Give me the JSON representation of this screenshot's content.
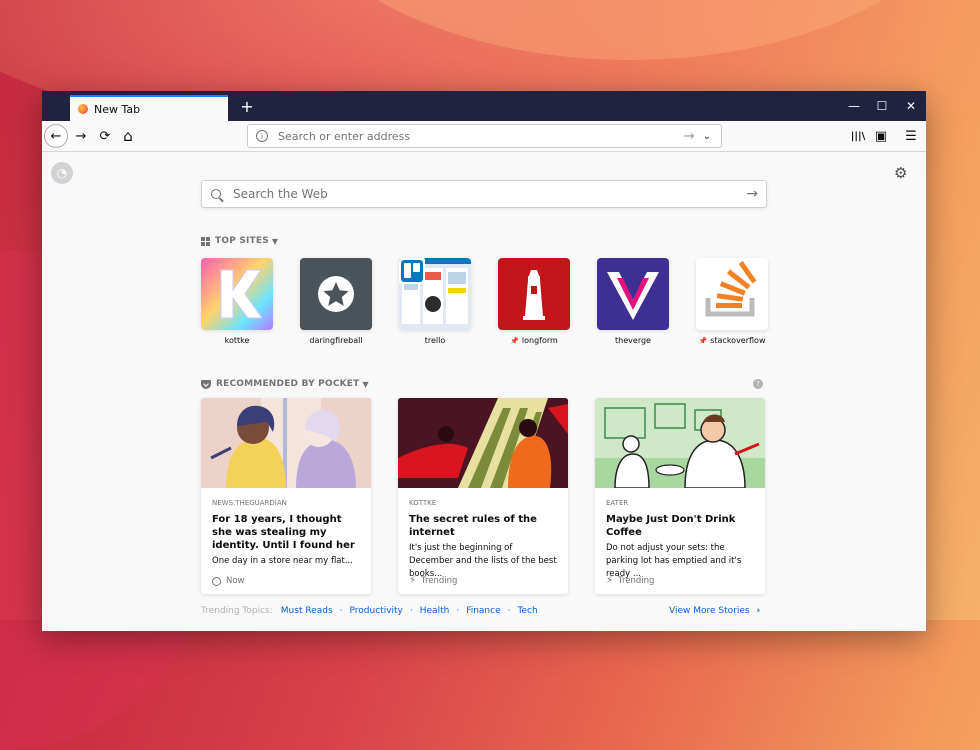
{
  "tab": {
    "title": "New Tab"
  },
  "titlebar": {
    "new_tab": "+",
    "minimize": "—",
    "maximize": "☐",
    "close": "✕"
  },
  "nav": {
    "back": "←",
    "forward": "→",
    "reload": "⟳",
    "home": "⌂"
  },
  "urlbar": {
    "placeholder": "Search or enter address",
    "info": "i",
    "go": "→",
    "dropdown": "⌄"
  },
  "toolbar": {
    "library": "|||\\",
    "sidebar": "▣",
    "menu": "☰"
  },
  "search": {
    "placeholder": "Search the Web",
    "go": "→"
  },
  "top_sites": {
    "heading": "TOP SITES",
    "items": [
      {
        "label": "kottke",
        "pinned": false
      },
      {
        "label": "daringfireball",
        "pinned": false
      },
      {
        "label": "trello",
        "pinned": false
      },
      {
        "label": "longform",
        "pinned": true
      },
      {
        "label": "theverge",
        "pinned": false
      },
      {
        "label": "stackoverflow",
        "pinned": true
      }
    ]
  },
  "pocket": {
    "heading": "RECOMMENDED BY POCKET",
    "help": "?",
    "cards": [
      {
        "source": "NEWS.THEGUARDIAN",
        "title": "For 18 years, I thought she was stealing my identity. Until I found her",
        "description": "One day in a store near my flat...",
        "context": "Now"
      },
      {
        "source": "KOTTKE",
        "title": "The secret rules of the internet",
        "description": "It's just the beginning of December and the lists of the best books...",
        "context": "Trending"
      },
      {
        "source": "EATER",
        "title": "Maybe Just Don't Drink Coffee",
        "description": "Do not adjust your sets: the parking lot has emptied and it's ready ...",
        "context": "Trending"
      }
    ]
  },
  "trending": {
    "label": "Trending Topics:",
    "topics": [
      "Must Reads",
      "Productivity",
      "Health",
      "Finance",
      "Tech"
    ],
    "more": "View More Stories"
  },
  "colors": {
    "accent": "#0a84ff",
    "link": "#0060df",
    "titlebar": "#202340"
  }
}
